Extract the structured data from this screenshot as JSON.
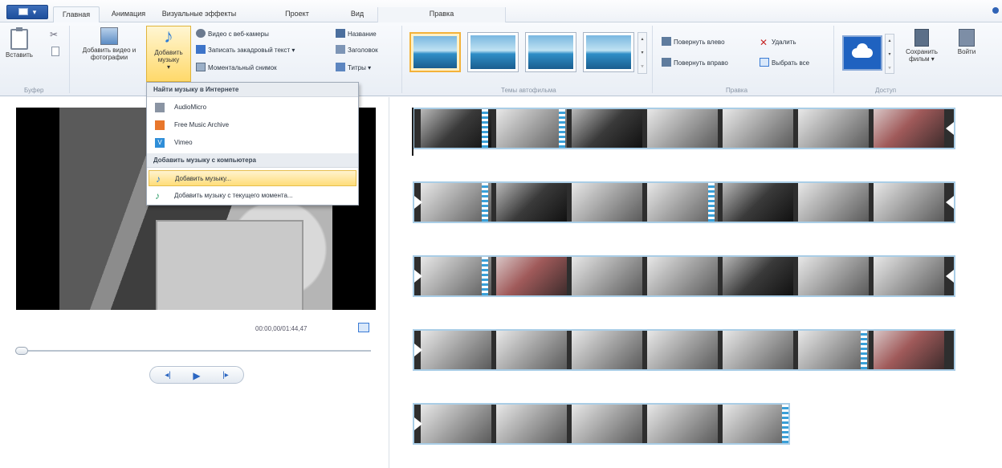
{
  "tabs": {
    "app_menu": "",
    "home": "Главная",
    "animation": "Анимация",
    "visual_effects": "Визуальные эффекты",
    "project": "Проект",
    "view": "Вид",
    "edit_context": "Правка"
  },
  "ribbon": {
    "clipboard": {
      "paste": "Вставить",
      "group": "Буфер"
    },
    "add": {
      "add_video_photos": "Добавить видео и фотографии",
      "add_music": "Добавить музыку",
      "webcam_video": "Видео с веб-камеры",
      "record_narration": "Записать закадровый текст",
      "snapshot": "Моментальный снимок",
      "title": "Название",
      "caption": "Заголовок",
      "credits": "Титры"
    },
    "themes_group": "Темы автофильма",
    "editing": {
      "rotate_left": "Повернуть влево",
      "rotate_right": "Повернуть вправо",
      "remove": "Удалить",
      "select_all": "Выбрать все",
      "group": "Правка"
    },
    "share": {
      "group": "Доступ",
      "save_movie": "Сохранить фильм",
      "sign_in": "Войти"
    }
  },
  "music_menu": {
    "online_header": "Найти музыку в Интернете",
    "online_items": [
      "AudioMicro",
      "Free Music Archive",
      "Vimeo"
    ],
    "pc_header": "Добавить музыку с компьютера",
    "pc_items": [
      "Добавить музыку...",
      "Добавить музыку с текущего момента..."
    ]
  },
  "preview": {
    "timecode": "00:00,00/01:44,47",
    "progress_fraction": 0.0
  },
  "icons": {
    "app": "app-menu-icon",
    "cut": "scissors-icon",
    "copy": "copy-icon",
    "music": "music-note-icon",
    "onedrive": "cloud-icon"
  },
  "colors": {
    "accent": "#2f7dd6",
    "highlight": "#ffdd7a",
    "film_border": "#a9cde6"
  }
}
